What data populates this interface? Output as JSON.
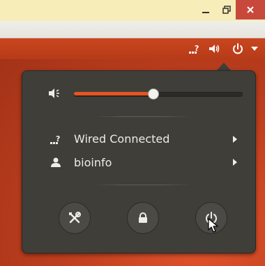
{
  "window_controls": {
    "minimize_icon": "minimize-icon",
    "maximize_icon": "maximize-icon",
    "close_icon": "close-icon"
  },
  "topbar": {
    "network_icon": "network-question-icon",
    "volume_icon": "volume-icon",
    "power_icon": "power-icon",
    "menu_icon": "chevron-down-icon"
  },
  "menu": {
    "volume": {
      "icon": "volume-icon",
      "level": 0.47
    },
    "network": {
      "label": "Wired Connected",
      "icon": "network-question-icon"
    },
    "user": {
      "label": "bioinfo",
      "icon": "user-icon"
    },
    "actions": [
      {
        "name": "settings",
        "icon": "settings-tools-icon"
      },
      {
        "name": "lock",
        "icon": "lock-icon"
      },
      {
        "name": "power",
        "icon": "power-icon"
      }
    ]
  },
  "colors": {
    "accent": "#e95420",
    "panel_bg": "#3f3e39",
    "topbar": "#c0401f",
    "close_button": "#c9483c"
  }
}
